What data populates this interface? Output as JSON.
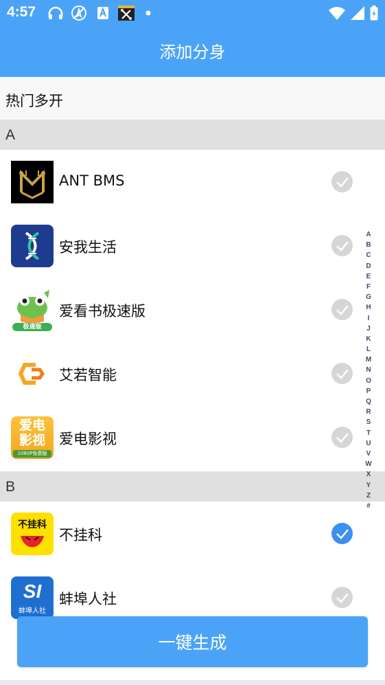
{
  "status_bar": {
    "time": "4:57",
    "icons": [
      "headset-icon",
      "no-location-icon",
      "a-badge-icon",
      "tools-icon",
      "dot-icon",
      "wifi-icon",
      "signal-icon",
      "battery-icon"
    ]
  },
  "header": {
    "title": "添加分身"
  },
  "hot": {
    "label": "热门多开"
  },
  "sections": [
    {
      "letter": "A",
      "apps": [
        {
          "name": "ANT BMS",
          "checked": false
        },
        {
          "name": "安我生活",
          "checked": false
        },
        {
          "name": "爱看书极速版",
          "checked": false
        },
        {
          "name": "艾若智能",
          "checked": false
        },
        {
          "name": "爱电影视",
          "checked": false
        }
      ]
    },
    {
      "letter": "B",
      "apps": [
        {
          "name": "不挂科",
          "checked": true
        },
        {
          "name": "蚌埠人社",
          "checked": false
        }
      ]
    }
  ],
  "icon_texts": {
    "aikanshu": "极速版",
    "aidian_top": "爱电",
    "aidian_mid": "影视",
    "aidian_bottom": "1080P免费版",
    "buguake": "不挂科",
    "bengbu_logo": "SI",
    "bengbu_sub": "蚌埠人社"
  },
  "alphabet": [
    "A",
    "B",
    "C",
    "D",
    "E",
    "F",
    "G",
    "H",
    "I",
    "J",
    "K",
    "L",
    "M",
    "N",
    "O",
    "P",
    "Q",
    "R",
    "S",
    "T",
    "U",
    "V",
    "W",
    "X",
    "Y",
    "Z",
    "#"
  ],
  "generate_button": {
    "label": "一键生成"
  },
  "colors": {
    "primary": "#4aa3f7",
    "check_on": "#3d8ff0",
    "check_off": "#d6d6d6",
    "section_bg": "#e0e0e0"
  }
}
